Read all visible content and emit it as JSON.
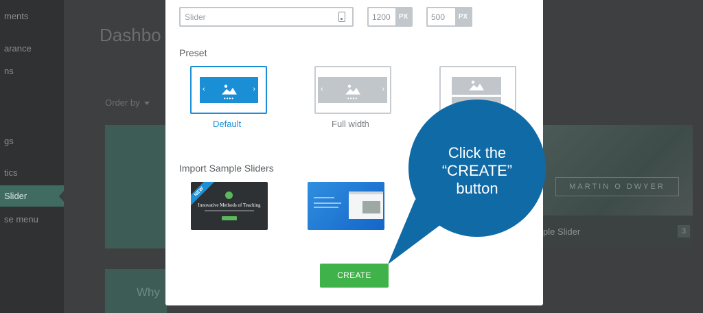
{
  "background": {
    "sidebar_items": [
      {
        "label": "ments"
      },
      {
        "label": "arance"
      },
      {
        "label": "ns"
      },
      {
        "label": "gs"
      },
      {
        "label": "tics"
      },
      {
        "label": "Slider",
        "active": true
      },
      {
        "label": "se menu"
      }
    ],
    "dashboard_title": "Dashbo",
    "order_by_label": "Order by",
    "card_left_text": "Why",
    "sample_card": {
      "banner_text": "MARTIN O DWYER",
      "caption": "ple Slider",
      "count": "3"
    }
  },
  "modal": {
    "name_field": {
      "placeholder": "Slider",
      "icon": "text-field-icon"
    },
    "width_field": {
      "value": "1200",
      "unit": "PX"
    },
    "height_field": {
      "value": "500",
      "unit": "PX"
    },
    "preset_label": "Preset",
    "presets": [
      {
        "name": "Default",
        "selected": true
      },
      {
        "name": "Full width",
        "selected": false
      },
      {
        "name": "",
        "selected": false
      }
    ],
    "import_label": "Import Sample Sliders",
    "samples": [
      {
        "badge": "NEW",
        "headline": "Innovative Methods of Teaching"
      },
      {
        "badge": "",
        "headline": ""
      }
    ],
    "create_label": "CREATE"
  },
  "callout": {
    "text": "Click the\n“CREATE”\nbutton",
    "color": "#0f6aa6"
  },
  "colors": {
    "accent": "#1a8fd6",
    "create_green": "#3fb34a",
    "callout_blue": "#0f6aa6"
  }
}
